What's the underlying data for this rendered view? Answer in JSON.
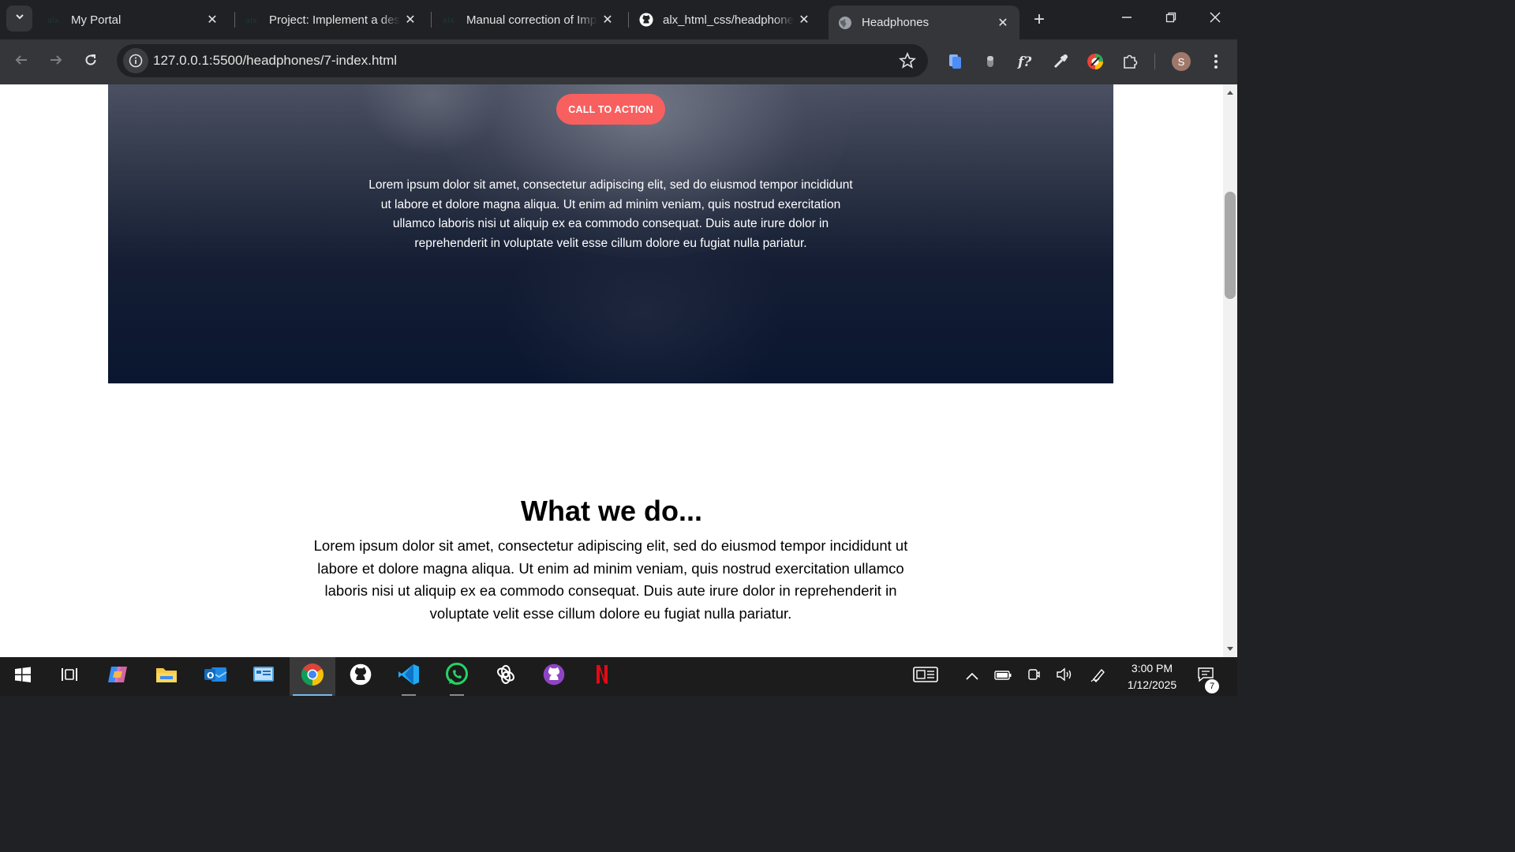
{
  "browser": {
    "tabs": [
      {
        "title": "My Portal",
        "favicon": "alx-favicon"
      },
      {
        "title": "Project: Implement a design",
        "favicon": "alx-favicon"
      },
      {
        "title": "Manual correction of Improvements",
        "favicon": "alx-favicon"
      },
      {
        "title": "alx_html_css/headphones",
        "favicon": "github-favicon"
      },
      {
        "title": "Headphones",
        "favicon": "globe-favicon",
        "active": true
      }
    ],
    "new_tab_label": "+",
    "url": "127.0.0.1:5500/headphones/7-index.html",
    "profile_initial": "S"
  },
  "page": {
    "cta_label": "CALL TO ACTION",
    "hero_text": "Lorem ipsum dolor sit amet, consectetur adipiscing elit, sed do eiusmod tempor incididunt ut labore et dolore magna aliqua. Ut enim ad minim veniam, quis nostrud exercitation ullamco laboris nisi ut aliquip ex ea commodo consequat. Duis aute irure dolor in reprehenderit in voluptate velit esse cillum dolore eu fugiat nulla pariatur.",
    "section_title": "What we do...",
    "section_text": "Lorem ipsum dolor sit amet, consectetur adipiscing elit, sed do eiusmod tempor incididunt ut labore et dolore magna aliqua. Ut enim ad minim veniam, quis nostrud exercitation ullamco laboris nisi ut aliquip ex ea commodo consequat. Duis aute irure dolor in reprehenderit in voluptate velit esse cillum dolore eu fugiat nulla pariatur.",
    "colors": {
      "cta": "#f85f5f",
      "hero_dark": "#0a1630"
    }
  },
  "taskbar": {
    "apps": [
      "windows-start",
      "task-view",
      "copilot",
      "file-explorer",
      "outlook",
      "control-panel",
      "chrome",
      "github-desktop",
      "vscode",
      "whatsapp",
      "chatgpt",
      "github-purple",
      "netflix"
    ],
    "time": "3:00 PM",
    "date": "1/12/2025",
    "notification_count": "7"
  }
}
